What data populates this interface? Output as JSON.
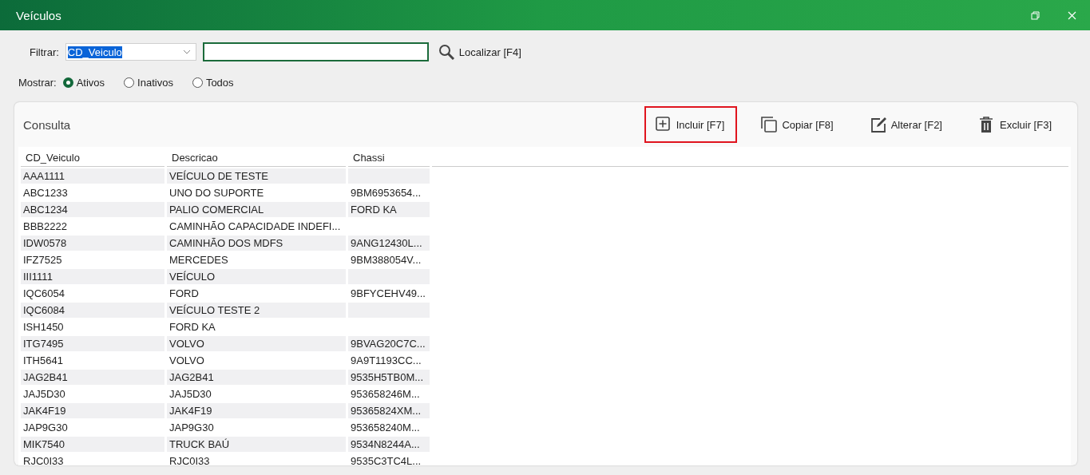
{
  "window": {
    "title": "Veículos"
  },
  "filter": {
    "label": "Filtrar:",
    "field": "CD_Veiculo",
    "search_button": "Localizar [F4]"
  },
  "show": {
    "label": "Mostrar:",
    "options": [
      {
        "label": "Ativos",
        "selected": true
      },
      {
        "label": "Inativos",
        "selected": false
      },
      {
        "label": "Todos",
        "selected": false
      }
    ]
  },
  "panel": {
    "title": "Consulta",
    "actions": [
      {
        "kind": "add",
        "label": "Incluir [F7]",
        "highlighted": true
      },
      {
        "kind": "copy",
        "label": "Copiar [F8]",
        "highlighted": false
      },
      {
        "kind": "edit",
        "label": "Alterar [F2]",
        "highlighted": false
      },
      {
        "kind": "delete",
        "label": "Excluir [F3]",
        "highlighted": false
      }
    ],
    "table": {
      "columns": [
        "CD_Veiculo",
        "Descricao",
        "Chassi"
      ],
      "rows": [
        [
          "AAA1111",
          "VEÍCULO DE TESTE",
          ""
        ],
        [
          "ABC1233",
          "UNO DO SUPORTE",
          "9BM6953654..."
        ],
        [
          "ABC1234",
          "PALIO COMERCIAL",
          "FORD KA"
        ],
        [
          "BBB2222",
          "CAMINHÃO CAPACIDADE INDEFI...",
          ""
        ],
        [
          "IDW0578",
          "CAMINHÃO DOS MDFS",
          "9ANG12430L..."
        ],
        [
          "IFZ7525",
          "MERCEDES",
          "9BM388054V..."
        ],
        [
          "III1111",
          "VEÍCULO",
          ""
        ],
        [
          "IQC6054",
          "FORD",
          "9BFYCEHV49..."
        ],
        [
          "IQC6084",
          "VEÍCULO TESTE 2",
          ""
        ],
        [
          "ISH1450",
          "FORD KA",
          ""
        ],
        [
          "ITG7495",
          "VOLVO",
          "9BVAG20C7C..."
        ],
        [
          "ITH5641",
          "VOLVO",
          "9A9T1193CC..."
        ],
        [
          "JAG2B41",
          "JAG2B41",
          "9535H5TB0M..."
        ],
        [
          "JAJ5D30",
          "JAJ5D30",
          "953658246M..."
        ],
        [
          "JAK4F19",
          "JAK4F19",
          "95365824XM..."
        ],
        [
          "JAP9G30",
          "JAP9G30",
          "953658240M..."
        ],
        [
          "MIK7540",
          "TRUCK BAÚ",
          "9534N8244A..."
        ],
        [
          "RJC0I33",
          "RJC0I33",
          "9535C3TC4L..."
        ]
      ]
    }
  }
}
